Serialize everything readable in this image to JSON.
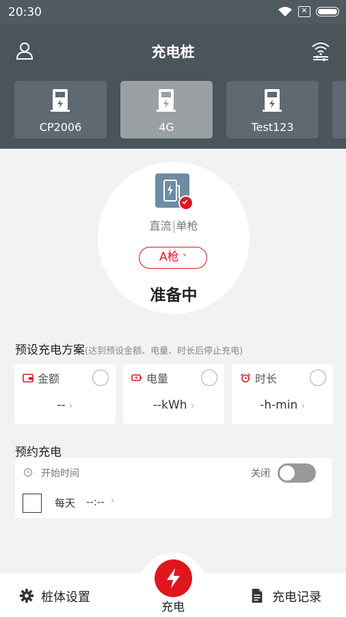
{
  "status_bar": {
    "time": "20:30"
  },
  "header": {
    "title": "充电桩"
  },
  "piles": [
    {
      "label": "CP2006",
      "active": false
    },
    {
      "label": "4G",
      "active": true
    },
    {
      "label": "Test123",
      "active": false
    }
  ],
  "gun": {
    "type_left": "直流",
    "type_right": "单枪",
    "selected": "A枪",
    "dropdown_arrow": "˅",
    "status": "准备中"
  },
  "plan": {
    "title": "预设充电方案",
    "hint": "(达到预设金额、电量、时长后停止充电)",
    "cards": [
      {
        "label": "金额",
        "value": "--",
        "icon": "wallet-icon"
      },
      {
        "label": "电量",
        "value": "--kWh",
        "icon": "battery-icon"
      },
      {
        "label": "时长",
        "value": "-h-min",
        "icon": "alarm-icon"
      }
    ],
    "arrow": "›"
  },
  "reserve": {
    "title": "预约充电",
    "start_label": "开始时间",
    "toggle_label": "关闭",
    "toggle_on": false,
    "daily_label": "每天",
    "time_value": "--:--",
    "arrow": "›"
  },
  "bottom_nav": {
    "settings": "桩体设置",
    "charge": "充电",
    "records": "充电记录"
  },
  "colors": {
    "accent": "#e0161e",
    "header": "#4a545b",
    "active_tab": "#9aa0a4"
  }
}
